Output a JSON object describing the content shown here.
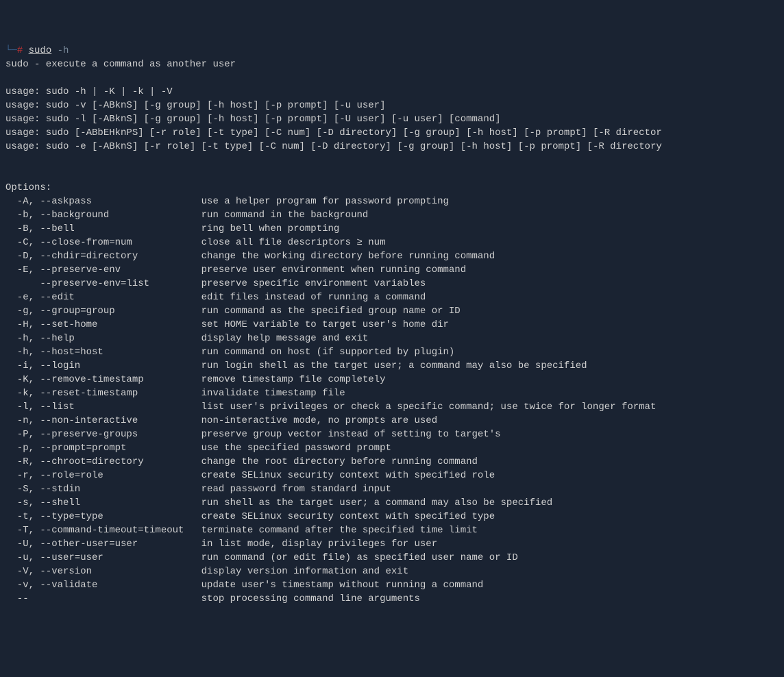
{
  "prompt": {
    "corner": "└─",
    "hash": "#",
    "command": "sudo",
    "arg": "-h"
  },
  "description": "sudo - execute a command as another user",
  "usage_lines": [
    "usage: sudo -h | -K | -k | -V",
    "usage: sudo -v [-ABknS] [-g group] [-h host] [-p prompt] [-u user]",
    "usage: sudo -l [-ABknS] [-g group] [-h host] [-p prompt] [-U user] [-u user] [command]",
    "usage: sudo [-ABbEHknPS] [-r role] [-t type] [-C num] [-D directory] [-g group] [-h host] [-p prompt] [-R director",
    "usage: sudo -e [-ABknS] [-r role] [-t type] [-C num] [-D directory] [-g group] [-h host] [-p prompt] [-R directory"
  ],
  "options_header": "Options:",
  "options": [
    {
      "flags": "-A, --askpass",
      "desc": "use a helper program for password prompting"
    },
    {
      "flags": "-b, --background",
      "desc": "run command in the background"
    },
    {
      "flags": "-B, --bell",
      "desc": "ring bell when prompting"
    },
    {
      "flags": "-C, --close-from=num",
      "desc": "close all file descriptors ≥ num"
    },
    {
      "flags": "-D, --chdir=directory",
      "desc": "change the working directory before running command"
    },
    {
      "flags": "-E, --preserve-env",
      "desc": "preserve user environment when running command"
    },
    {
      "flags": "    --preserve-env=list",
      "desc": "preserve specific environment variables"
    },
    {
      "flags": "-e, --edit",
      "desc": "edit files instead of running a command"
    },
    {
      "flags": "-g, --group=group",
      "desc": "run command as the specified group name or ID"
    },
    {
      "flags": "-H, --set-home",
      "desc": "set HOME variable to target user's home dir"
    },
    {
      "flags": "-h, --help",
      "desc": "display help message and exit"
    },
    {
      "flags": "-h, --host=host",
      "desc": "run command on host (if supported by plugin)"
    },
    {
      "flags": "-i, --login",
      "desc": "run login shell as the target user; a command may also be specified"
    },
    {
      "flags": "-K, --remove-timestamp",
      "desc": "remove timestamp file completely"
    },
    {
      "flags": "-k, --reset-timestamp",
      "desc": "invalidate timestamp file"
    },
    {
      "flags": "-l, --list",
      "desc": "list user's privileges or check a specific command; use twice for longer format"
    },
    {
      "flags": "-n, --non-interactive",
      "desc": "non-interactive mode, no prompts are used"
    },
    {
      "flags": "-P, --preserve-groups",
      "desc": "preserve group vector instead of setting to target's"
    },
    {
      "flags": "-p, --prompt=prompt",
      "desc": "use the specified password prompt"
    },
    {
      "flags": "-R, --chroot=directory",
      "desc": "change the root directory before running command"
    },
    {
      "flags": "-r, --role=role",
      "desc": "create SELinux security context with specified role"
    },
    {
      "flags": "-S, --stdin",
      "desc": "read password from standard input"
    },
    {
      "flags": "-s, --shell",
      "desc": "run shell as the target user; a command may also be specified"
    },
    {
      "flags": "-t, --type=type",
      "desc": "create SELinux security context with specified type"
    },
    {
      "flags": "-T, --command-timeout=timeout",
      "desc": "terminate command after the specified time limit"
    },
    {
      "flags": "-U, --other-user=user",
      "desc": "in list mode, display privileges for user"
    },
    {
      "flags": "-u, --user=user",
      "desc": "run command (or edit file) as specified user name or ID"
    },
    {
      "flags": "-V, --version",
      "desc": "display version information and exit"
    },
    {
      "flags": "-v, --validate",
      "desc": "update user's timestamp without running a command"
    },
    {
      "flags": "--",
      "desc": "stop processing command line arguments"
    }
  ]
}
